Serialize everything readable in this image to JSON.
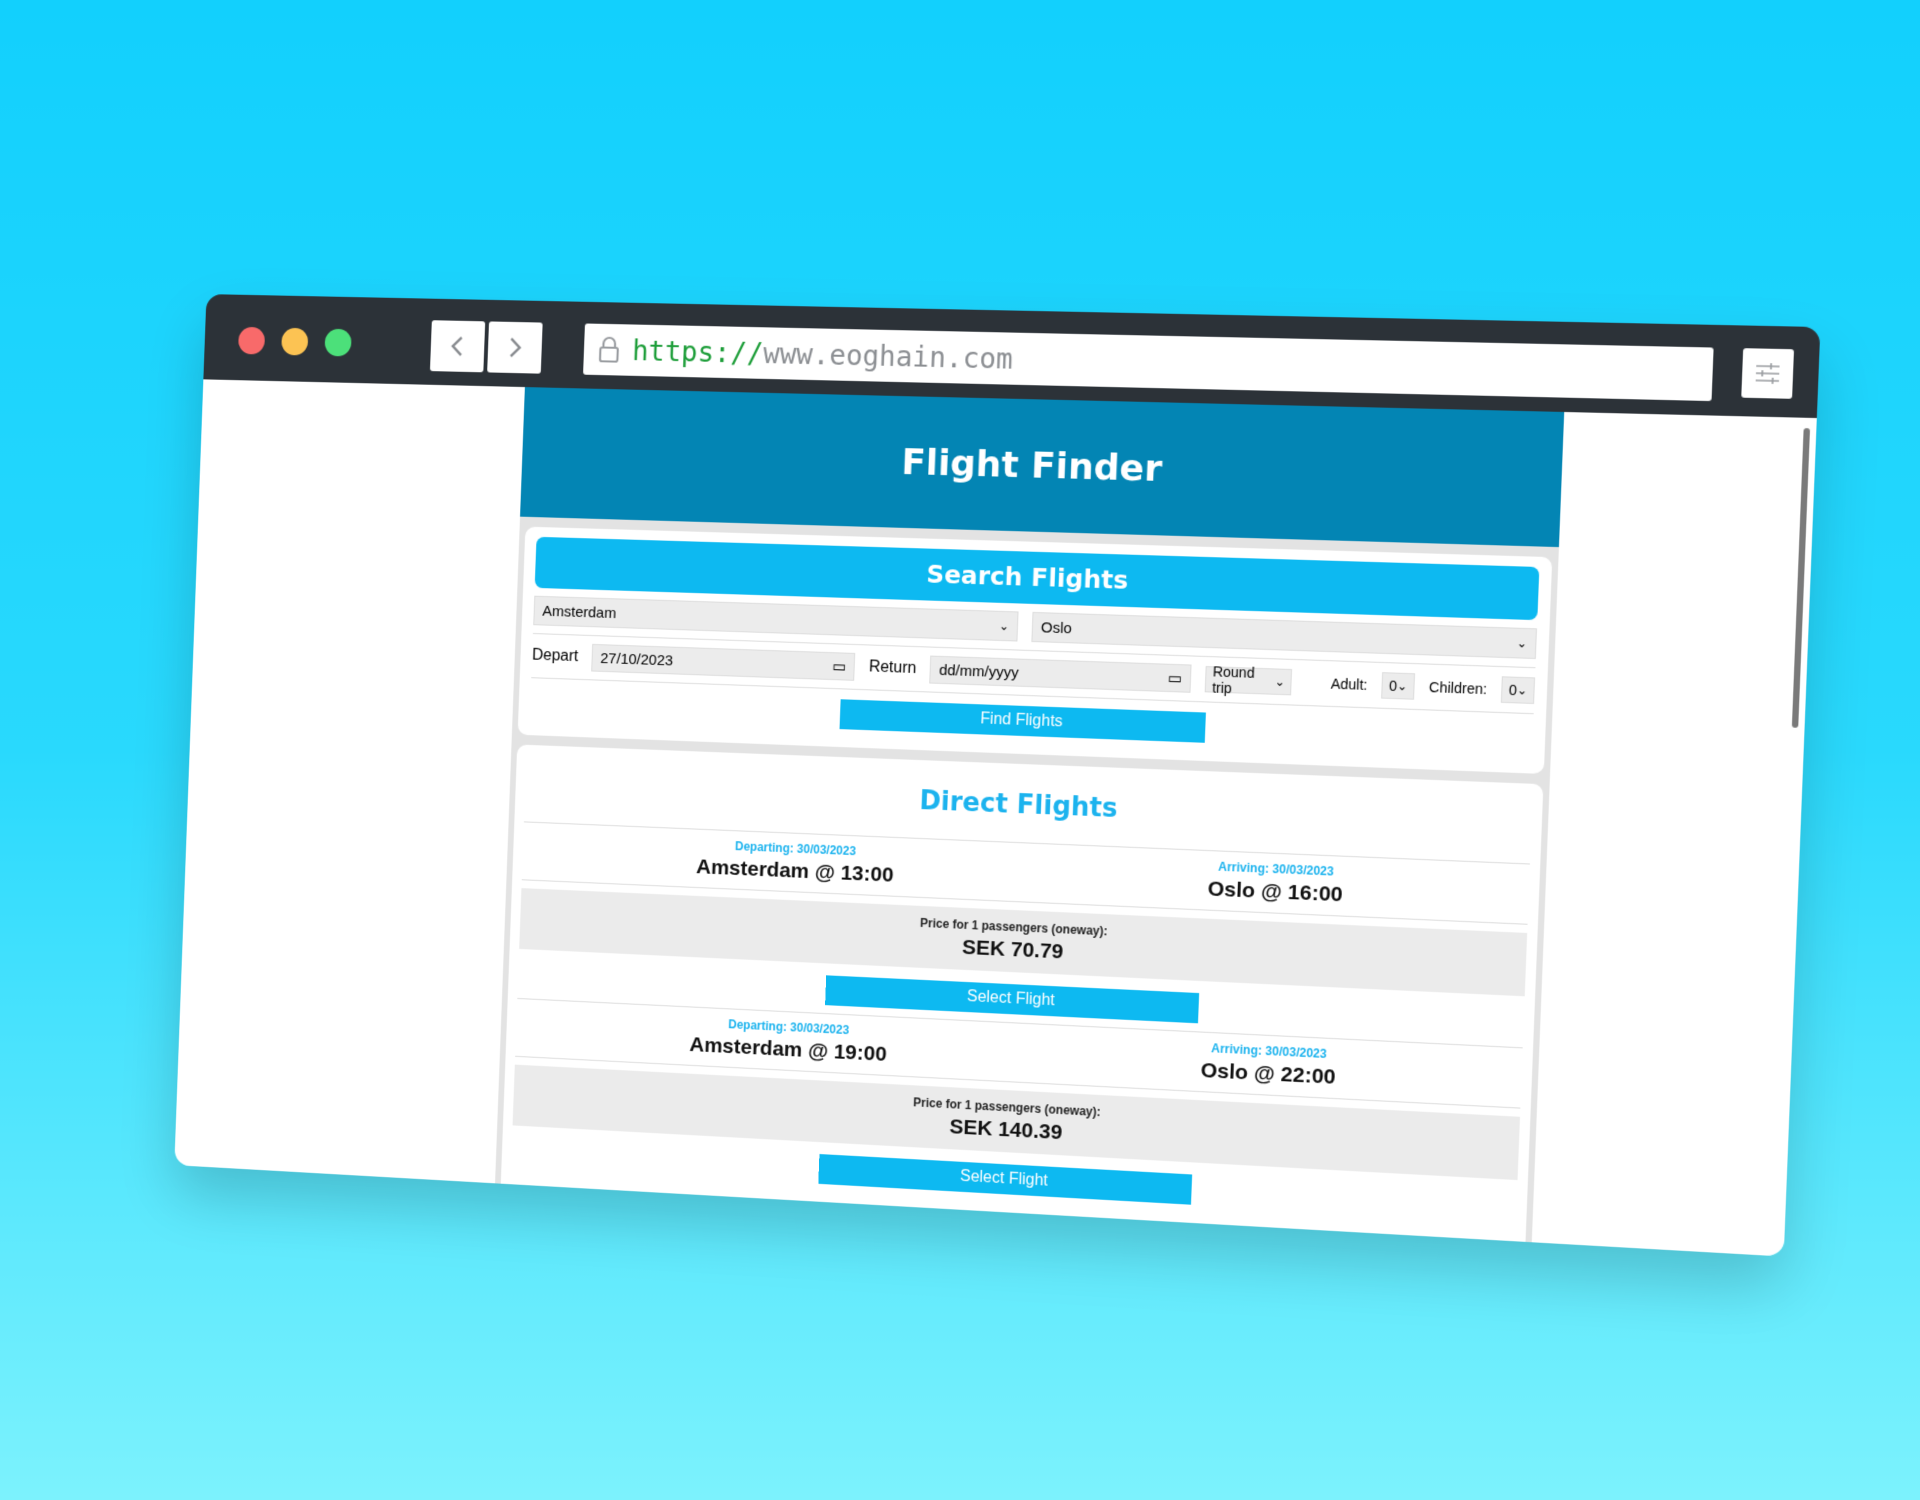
{
  "browser": {
    "url_scheme": "https://",
    "url_host": "www.eoghain.com"
  },
  "header": {
    "title": "Flight Finder"
  },
  "search": {
    "title": "Search Flights",
    "origin": "Amsterdam",
    "destination": "Oslo",
    "depart_label": "Depart",
    "depart_value": "27/10/2023",
    "return_label": "Return",
    "return_placeholder": "dd/mm/yyyy",
    "trip_type": "Round trip",
    "adult_label": "Adult:",
    "adult_value": "0",
    "children_label": "Children:",
    "children_value": "0",
    "find_button": "Find Flights"
  },
  "results": {
    "title": "Direct Flights",
    "flights": [
      {
        "departing_label": "Departing: 30/03/2023",
        "departing_value": "Amsterdam @ 13:00",
        "arriving_label": "Arriving: 30/03/2023",
        "arriving_value": "Oslo @ 16:00",
        "price_label": "Price for 1 passengers (oneway):",
        "price_value": "SEK 70.79",
        "select_button": "Select Flight"
      },
      {
        "departing_label": "Departing: 30/03/2023",
        "departing_value": "Amsterdam @ 19:00",
        "arriving_label": "Arriving: 30/03/2023",
        "arriving_value": "Oslo @ 22:00",
        "price_label": "Price for 1 passengers (oneway):",
        "price_value": "SEK 140.39",
        "select_button": "Select Flight"
      }
    ]
  },
  "colors": {
    "background_top": "#12d0fd",
    "background_bottom": "#7cf2fd",
    "chrome": "#2c3238",
    "hero": "#0385b4",
    "accent": "#0db9f1"
  }
}
